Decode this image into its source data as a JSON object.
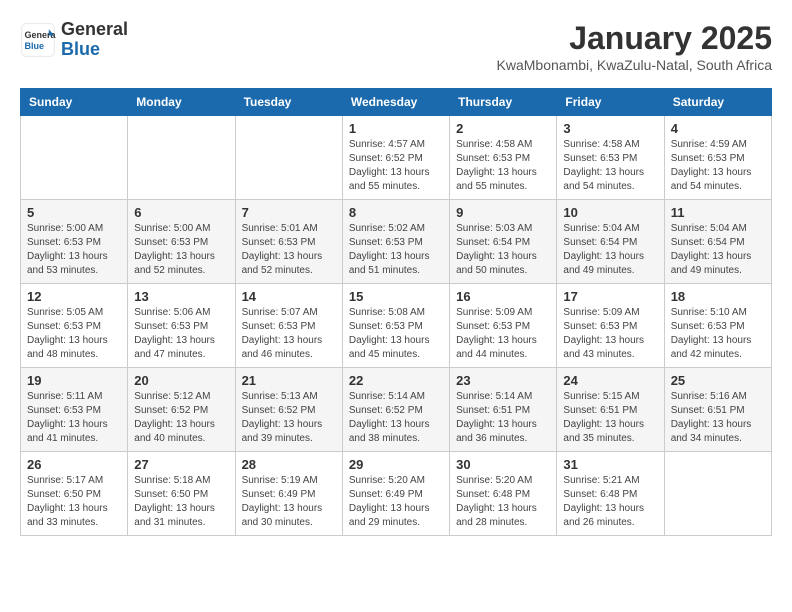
{
  "header": {
    "logo_general": "General",
    "logo_blue": "Blue",
    "month_title": "January 2025",
    "location": "KwaMbonambi, KwaZulu-Natal, South Africa"
  },
  "days_of_week": [
    "Sunday",
    "Monday",
    "Tuesday",
    "Wednesday",
    "Thursday",
    "Friday",
    "Saturday"
  ],
  "weeks": [
    [
      {
        "num": "",
        "info": ""
      },
      {
        "num": "",
        "info": ""
      },
      {
        "num": "",
        "info": ""
      },
      {
        "num": "1",
        "info": "Sunrise: 4:57 AM\nSunset: 6:52 PM\nDaylight: 13 hours\nand 55 minutes."
      },
      {
        "num": "2",
        "info": "Sunrise: 4:58 AM\nSunset: 6:53 PM\nDaylight: 13 hours\nand 55 minutes."
      },
      {
        "num": "3",
        "info": "Sunrise: 4:58 AM\nSunset: 6:53 PM\nDaylight: 13 hours\nand 54 minutes."
      },
      {
        "num": "4",
        "info": "Sunrise: 4:59 AM\nSunset: 6:53 PM\nDaylight: 13 hours\nand 54 minutes."
      }
    ],
    [
      {
        "num": "5",
        "info": "Sunrise: 5:00 AM\nSunset: 6:53 PM\nDaylight: 13 hours\nand 53 minutes."
      },
      {
        "num": "6",
        "info": "Sunrise: 5:00 AM\nSunset: 6:53 PM\nDaylight: 13 hours\nand 52 minutes."
      },
      {
        "num": "7",
        "info": "Sunrise: 5:01 AM\nSunset: 6:53 PM\nDaylight: 13 hours\nand 52 minutes."
      },
      {
        "num": "8",
        "info": "Sunrise: 5:02 AM\nSunset: 6:53 PM\nDaylight: 13 hours\nand 51 minutes."
      },
      {
        "num": "9",
        "info": "Sunrise: 5:03 AM\nSunset: 6:54 PM\nDaylight: 13 hours\nand 50 minutes."
      },
      {
        "num": "10",
        "info": "Sunrise: 5:04 AM\nSunset: 6:54 PM\nDaylight: 13 hours\nand 49 minutes."
      },
      {
        "num": "11",
        "info": "Sunrise: 5:04 AM\nSunset: 6:54 PM\nDaylight: 13 hours\nand 49 minutes."
      }
    ],
    [
      {
        "num": "12",
        "info": "Sunrise: 5:05 AM\nSunset: 6:53 PM\nDaylight: 13 hours\nand 48 minutes."
      },
      {
        "num": "13",
        "info": "Sunrise: 5:06 AM\nSunset: 6:53 PM\nDaylight: 13 hours\nand 47 minutes."
      },
      {
        "num": "14",
        "info": "Sunrise: 5:07 AM\nSunset: 6:53 PM\nDaylight: 13 hours\nand 46 minutes."
      },
      {
        "num": "15",
        "info": "Sunrise: 5:08 AM\nSunset: 6:53 PM\nDaylight: 13 hours\nand 45 minutes."
      },
      {
        "num": "16",
        "info": "Sunrise: 5:09 AM\nSunset: 6:53 PM\nDaylight: 13 hours\nand 44 minutes."
      },
      {
        "num": "17",
        "info": "Sunrise: 5:09 AM\nSunset: 6:53 PM\nDaylight: 13 hours\nand 43 minutes."
      },
      {
        "num": "18",
        "info": "Sunrise: 5:10 AM\nSunset: 6:53 PM\nDaylight: 13 hours\nand 42 minutes."
      }
    ],
    [
      {
        "num": "19",
        "info": "Sunrise: 5:11 AM\nSunset: 6:53 PM\nDaylight: 13 hours\nand 41 minutes."
      },
      {
        "num": "20",
        "info": "Sunrise: 5:12 AM\nSunset: 6:52 PM\nDaylight: 13 hours\nand 40 minutes."
      },
      {
        "num": "21",
        "info": "Sunrise: 5:13 AM\nSunset: 6:52 PM\nDaylight: 13 hours\nand 39 minutes."
      },
      {
        "num": "22",
        "info": "Sunrise: 5:14 AM\nSunset: 6:52 PM\nDaylight: 13 hours\nand 38 minutes."
      },
      {
        "num": "23",
        "info": "Sunrise: 5:14 AM\nSunset: 6:51 PM\nDaylight: 13 hours\nand 36 minutes."
      },
      {
        "num": "24",
        "info": "Sunrise: 5:15 AM\nSunset: 6:51 PM\nDaylight: 13 hours\nand 35 minutes."
      },
      {
        "num": "25",
        "info": "Sunrise: 5:16 AM\nSunset: 6:51 PM\nDaylight: 13 hours\nand 34 minutes."
      }
    ],
    [
      {
        "num": "26",
        "info": "Sunrise: 5:17 AM\nSunset: 6:50 PM\nDaylight: 13 hours\nand 33 minutes."
      },
      {
        "num": "27",
        "info": "Sunrise: 5:18 AM\nSunset: 6:50 PM\nDaylight: 13 hours\nand 31 minutes."
      },
      {
        "num": "28",
        "info": "Sunrise: 5:19 AM\nSunset: 6:49 PM\nDaylight: 13 hours\nand 30 minutes."
      },
      {
        "num": "29",
        "info": "Sunrise: 5:20 AM\nSunset: 6:49 PM\nDaylight: 13 hours\nand 29 minutes."
      },
      {
        "num": "30",
        "info": "Sunrise: 5:20 AM\nSunset: 6:48 PM\nDaylight: 13 hours\nand 28 minutes."
      },
      {
        "num": "31",
        "info": "Sunrise: 5:21 AM\nSunset: 6:48 PM\nDaylight: 13 hours\nand 26 minutes."
      },
      {
        "num": "",
        "info": ""
      }
    ]
  ]
}
